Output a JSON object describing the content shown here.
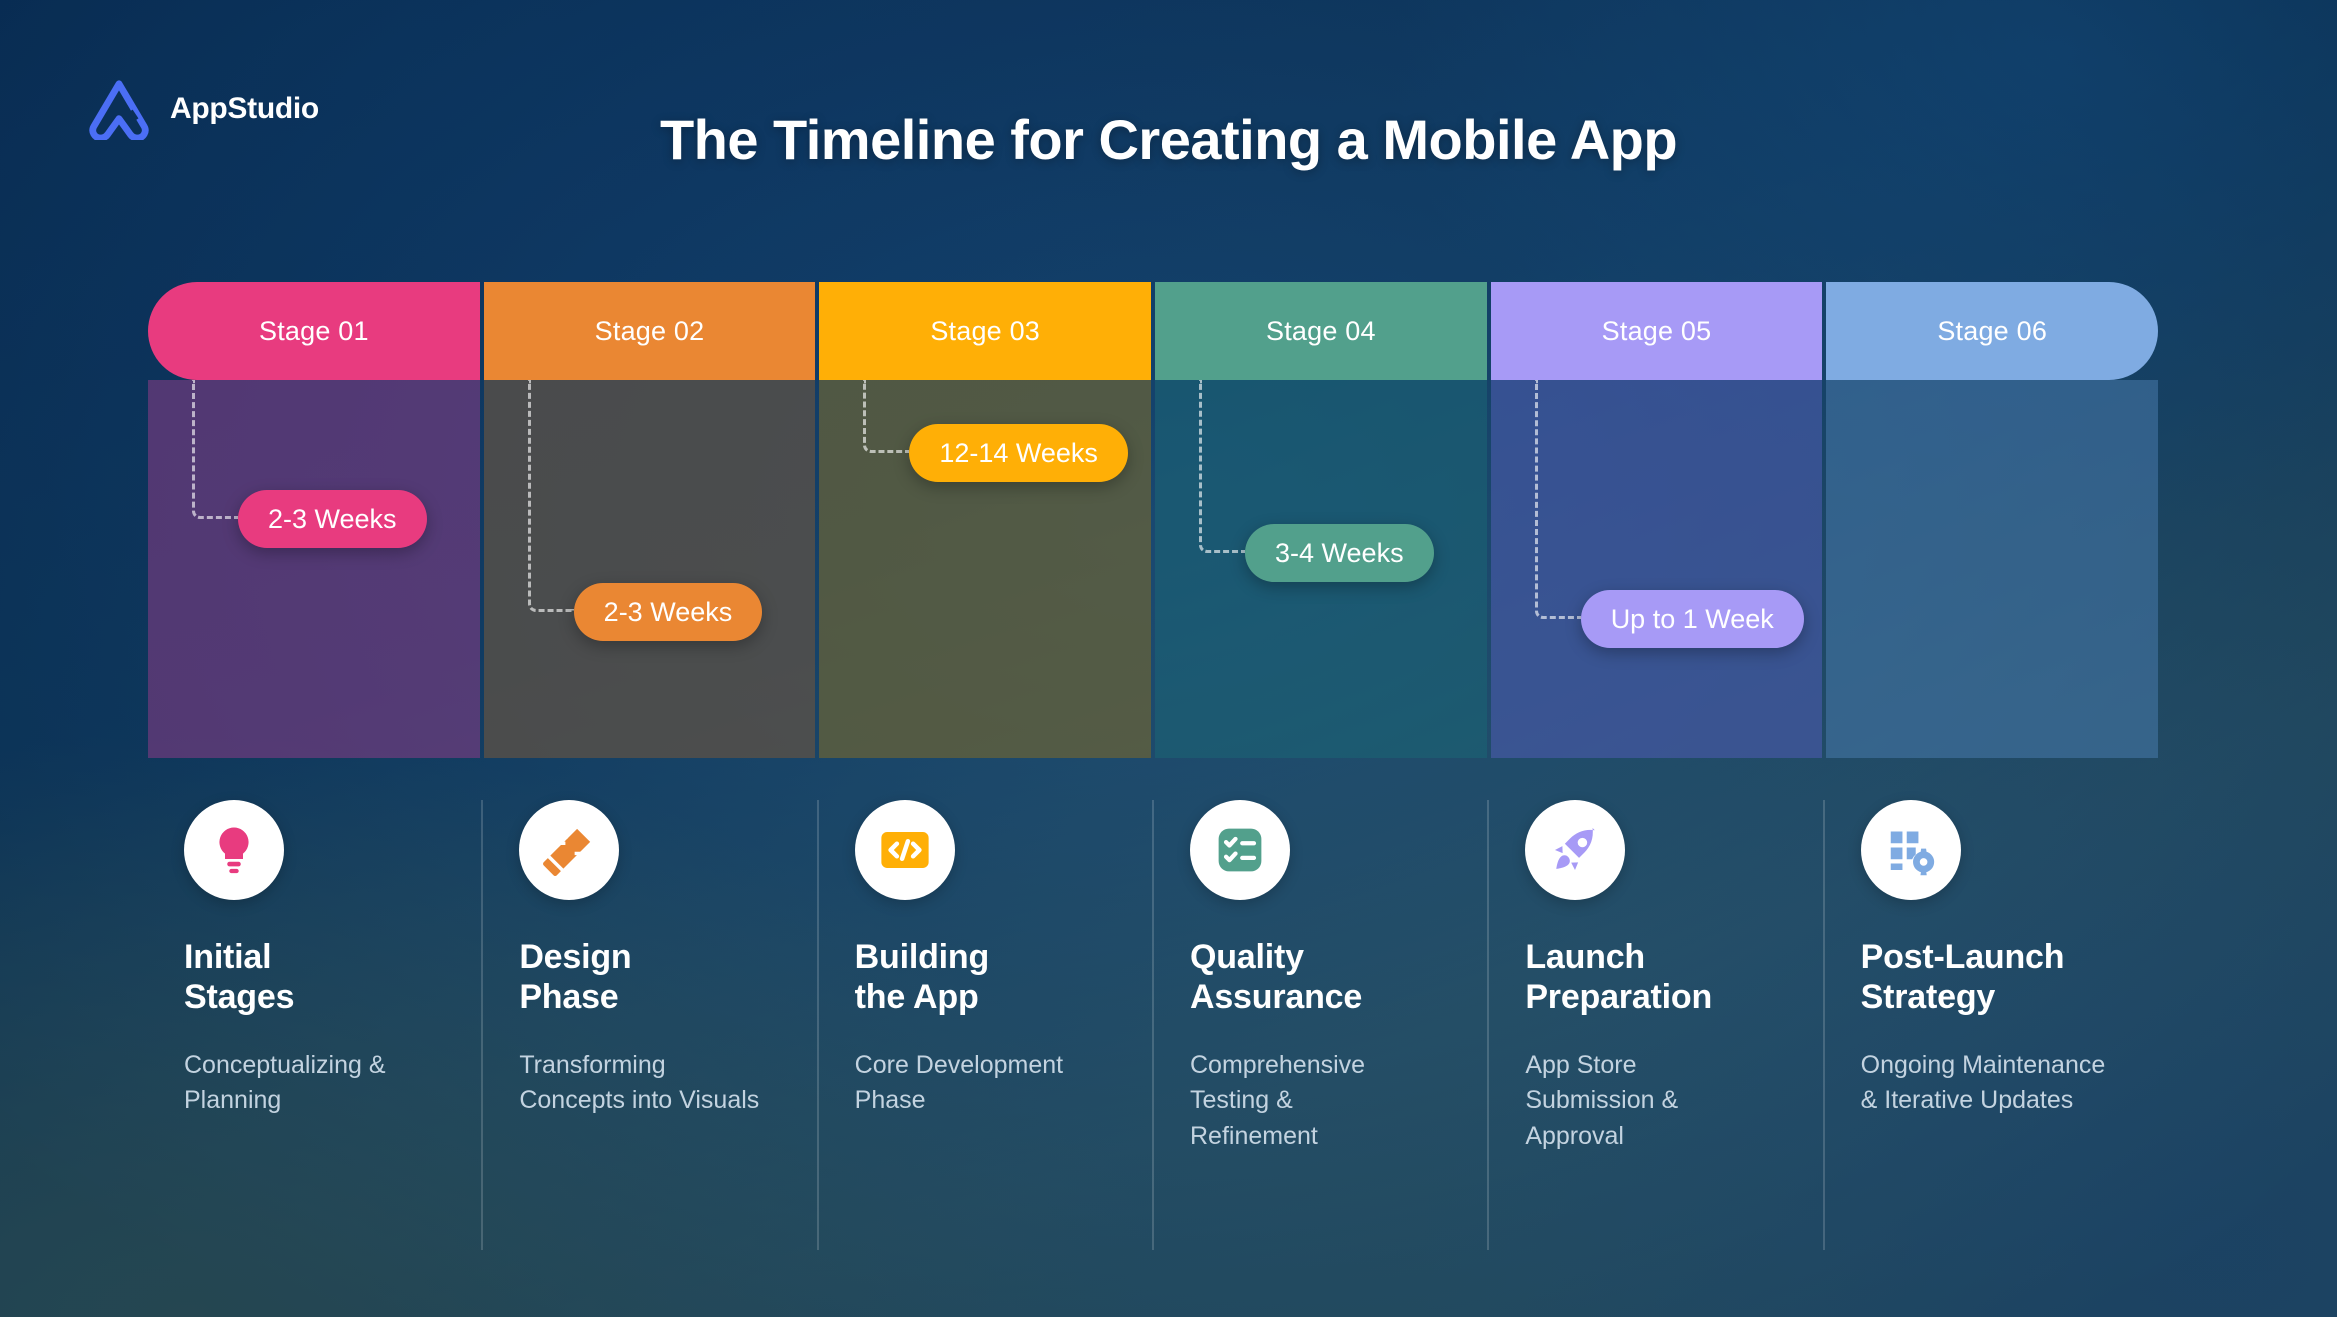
{
  "brand": {
    "name": "AppStudio",
    "logo_icon": "appstudio-triangle-logo",
    "logo_color": "#4b6ef5"
  },
  "header": {
    "title": "The Timeline for Creating a Mobile App"
  },
  "timeline": {
    "stages": [
      {
        "label": "Stage 01",
        "color": "#e83b7f",
        "duration": "2-3 Weeks",
        "body_tint": "#8d3d86",
        "body_alpha": 0.55
      },
      {
        "label": "Stage 02",
        "color": "#ea8733",
        "duration": "2-3 Weeks",
        "body_tint": "#5b5147",
        "body_alpha": 0.78
      },
      {
        "label": "Stage 03",
        "color": "#ffaf06",
        "duration": "12-14 Weeks",
        "body_tint": "#6a6236",
        "body_alpha": 0.72
      },
      {
        "label": "Stage 04",
        "color": "#52a08c",
        "duration": "3-4 Weeks",
        "body_tint": "#1b6274",
        "body_alpha": 0.62
      },
      {
        "label": "Stage 05",
        "color": "#a79af6",
        "duration": "Up to 1 Week",
        "body_tint": "#4a5bab",
        "body_alpha": 0.62
      },
      {
        "label": "Stage 06",
        "color": "#7fabe2",
        "duration": "",
        "body_tint": "#4b7cae",
        "body_alpha": 0.52
      }
    ]
  },
  "cards": [
    {
      "icon": "lightbulb-icon",
      "icon_color": "#e83b7f",
      "title": "Initial\nStages",
      "desc": "Conceptualizing &\nPlanning"
    },
    {
      "icon": "pencil-ruler-icon",
      "icon_color": "#ea8733",
      "title": "Design\nPhase",
      "desc": "Transforming\nConcepts into Visuals"
    },
    {
      "icon": "code-tag-icon",
      "icon_color": "#ffaf06",
      "title": "Building\nthe App",
      "desc": "Core Development\nPhase"
    },
    {
      "icon": "checklist-icon",
      "icon_color": "#52a08c",
      "title": "Quality\nAssurance",
      "desc": "Comprehensive\nTesting &\nRefinement"
    },
    {
      "icon": "rocket-icon",
      "icon_color": "#a79af6",
      "title": "Launch\nPreparation",
      "desc": "App Store\nSubmission &\nApproval"
    },
    {
      "icon": "grid-gear-icon",
      "icon_color": "#7fabe2",
      "title": "Post-Launch\nStrategy",
      "desc": "Ongoing Maintenance\n& Iterative Updates"
    }
  ]
}
